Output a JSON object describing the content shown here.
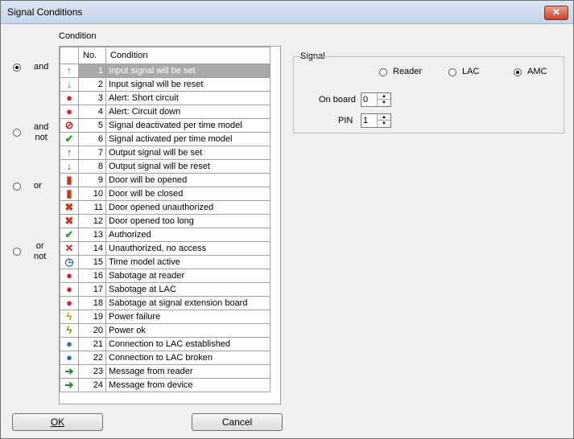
{
  "window": {
    "title": "Signal Conditions",
    "close_label": "✕"
  },
  "condition_label": "Condition",
  "logic_options": [
    {
      "id": "and",
      "line1": "and",
      "line2": "",
      "checked": true
    },
    {
      "id": "and-not",
      "line1": "and",
      "line2": "not",
      "checked": false
    },
    {
      "id": "or",
      "line1": "or",
      "line2": "",
      "checked": false
    },
    {
      "id": "or-not",
      "line1": "or",
      "line2": "not",
      "checked": false
    }
  ],
  "table": {
    "headers": [
      "",
      "No.",
      "Condition"
    ],
    "rows": [
      {
        "no": "1",
        "text": "Input signal will be set",
        "icon": "green-up-arrow-icon",
        "glyph": "↑",
        "color": "#1fa51f",
        "selected": true
      },
      {
        "no": "2",
        "text": "Input signal will be reset",
        "icon": "green-down-arrow-icon",
        "glyph": "↓",
        "color": "#1fa51f"
      },
      {
        "no": "3",
        "text": "Alert: Short circuit",
        "icon": "red-alarm-icon",
        "glyph": "●",
        "color": "#d42020"
      },
      {
        "no": "4",
        "text": "Alert: Circuit down",
        "icon": "red-alarm-icon",
        "glyph": "●",
        "color": "#d42020"
      },
      {
        "no": "5",
        "text": "Signal deactivated per time model",
        "icon": "red-stop-icon",
        "glyph": "⊘",
        "color": "#d42020"
      },
      {
        "no": "6",
        "text": "Signal activated per time model",
        "icon": "green-check-circle-icon",
        "glyph": "✔",
        "color": "#1fa51f"
      },
      {
        "no": "7",
        "text": "Output signal will be set",
        "icon": "red-up-arrow-icon",
        "glyph": "↑",
        "color": "#d42020"
      },
      {
        "no": "8",
        "text": "Output signal will be reset",
        "icon": "red-down-arrow-icon",
        "glyph": "↓",
        "color": "#d42020"
      },
      {
        "no": "9",
        "text": "Door will be opened",
        "icon": "door-open-icon",
        "glyph": "▮",
        "color": "#c63a1a"
      },
      {
        "no": "10",
        "text": "Door will be closed",
        "icon": "door-closed-icon",
        "glyph": "▮",
        "color": "#c63a1a"
      },
      {
        "no": "11",
        "text": "Door opened unauthorized",
        "icon": "door-unauthorized-icon",
        "glyph": "✖",
        "color": "#c63a1a"
      },
      {
        "no": "12",
        "text": "Door opened too long",
        "icon": "door-too-long-icon",
        "glyph": "✖",
        "color": "#c63a1a"
      },
      {
        "no": "13",
        "text": "Authorized",
        "icon": "green-checkmark-icon",
        "glyph": "✔",
        "color": "#1fa51f"
      },
      {
        "no": "14",
        "text": "Unauthorized, no access",
        "icon": "red-x-icon",
        "glyph": "✕",
        "color": "#d42020"
      },
      {
        "no": "15",
        "text": "Time model active",
        "icon": "clock-icon",
        "glyph": "◷",
        "color": "#3a6ea5"
      },
      {
        "no": "16",
        "text": "Sabotage at reader",
        "icon": "sabotage-icon",
        "glyph": "●",
        "color": "#d42020"
      },
      {
        "no": "17",
        "text": "Sabotage at LAC",
        "icon": "sabotage-icon",
        "glyph": "●",
        "color": "#d42020"
      },
      {
        "no": "18",
        "text": "Sabotage at signal extension board",
        "icon": "sabotage-icon",
        "glyph": "●",
        "color": "#d42020"
      },
      {
        "no": "19",
        "text": "Power failure",
        "icon": "power-failure-icon",
        "glyph": "ϟ",
        "color": "#c9a000"
      },
      {
        "no": "20",
        "text": "Power ok",
        "icon": "power-ok-icon",
        "glyph": "ϟ",
        "color": "#6a9a00"
      },
      {
        "no": "21",
        "text": "Connection to LAC established",
        "icon": "globe-check-icon",
        "glyph": "●",
        "color": "#2a6fb0"
      },
      {
        "no": "22",
        "text": "Connection to LAC broken",
        "icon": "globe-x-icon",
        "glyph": "●",
        "color": "#2a6fb0"
      },
      {
        "no": "23",
        "text": "Message from reader",
        "icon": "message-arrow-icon",
        "glyph": "➔",
        "color": "#2a8a2a"
      },
      {
        "no": "24",
        "text": "Message from device",
        "icon": "message-arrow-icon",
        "glyph": "➔",
        "color": "#2a8a2a"
      }
    ]
  },
  "signal": {
    "label": "Signal",
    "options": [
      {
        "label": "Reader",
        "checked": false
      },
      {
        "label": "LAC",
        "checked": false
      },
      {
        "label": "AMC",
        "checked": true
      }
    ],
    "onboard_label": "On board",
    "onboard_value": "0",
    "pin_label": "PIN",
    "pin_value": "1"
  },
  "buttons": {
    "ok": "OK",
    "cancel": "Cancel"
  }
}
